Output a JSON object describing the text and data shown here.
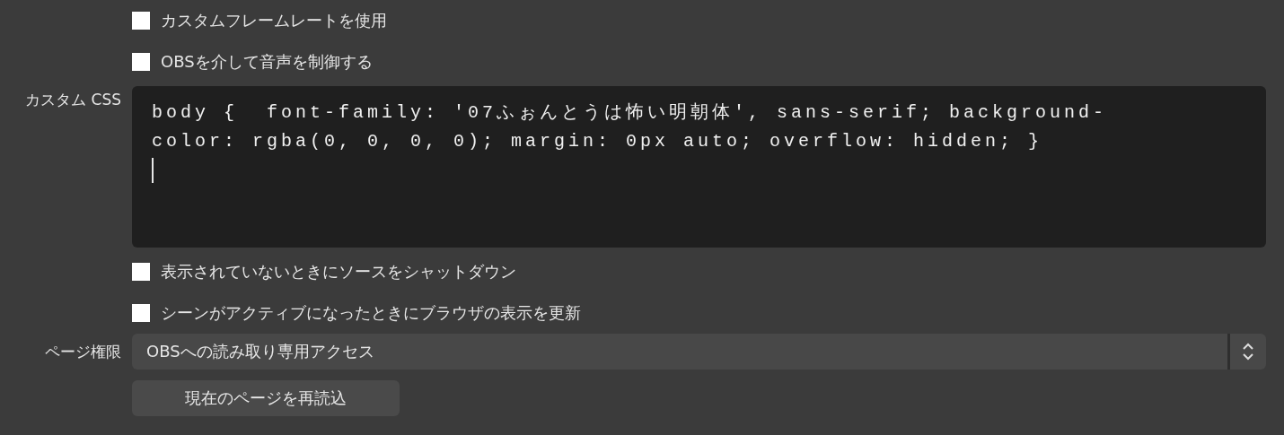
{
  "checkboxes_top": [
    {
      "label": "カスタムフレームレートを使用",
      "checked": false
    },
    {
      "label": "OBSを介して音声を制御する",
      "checked": false
    }
  ],
  "custom_css": {
    "label": "カスタム CSS",
    "value": "body {  font-family: '07ふぉんとうは怖い明朝体', sans-serif; background-color: rgba(0, 0, 0, 0); margin: 0px auto; overflow: hidden; }"
  },
  "checkboxes_bottom": [
    {
      "label": "表示されていないときにソースをシャットダウン",
      "checked": false
    },
    {
      "label": "シーンがアクティブになったときにブラウザの表示を更新",
      "checked": false
    }
  ],
  "page_permissions": {
    "label": "ページ権限",
    "value": "OBSへの読み取り専用アクセス"
  },
  "reload_button": "現在のページを再読込"
}
